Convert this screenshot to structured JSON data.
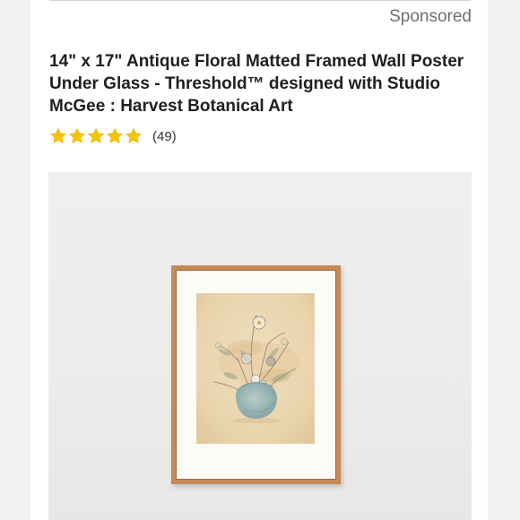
{
  "ad": {
    "sponsored_label": "Sponsored"
  },
  "product": {
    "title": "14\" x 17\" Antique Floral Matted Framed Wall Poster Under Glass - Threshold™ designed with Studio McGee : Harvest Botanical Art",
    "rating": {
      "stars": 5,
      "max_stars": 5,
      "review_count_label": "(49)"
    },
    "image": {
      "frame_color": "#c58a55",
      "mat_color": "#fbfbf8",
      "art_background": "#ead7b4"
    }
  },
  "colors": {
    "star_fill": "#f7c400",
    "title_text": "#1f1f1f",
    "muted_text": "#6f6f6f"
  }
}
